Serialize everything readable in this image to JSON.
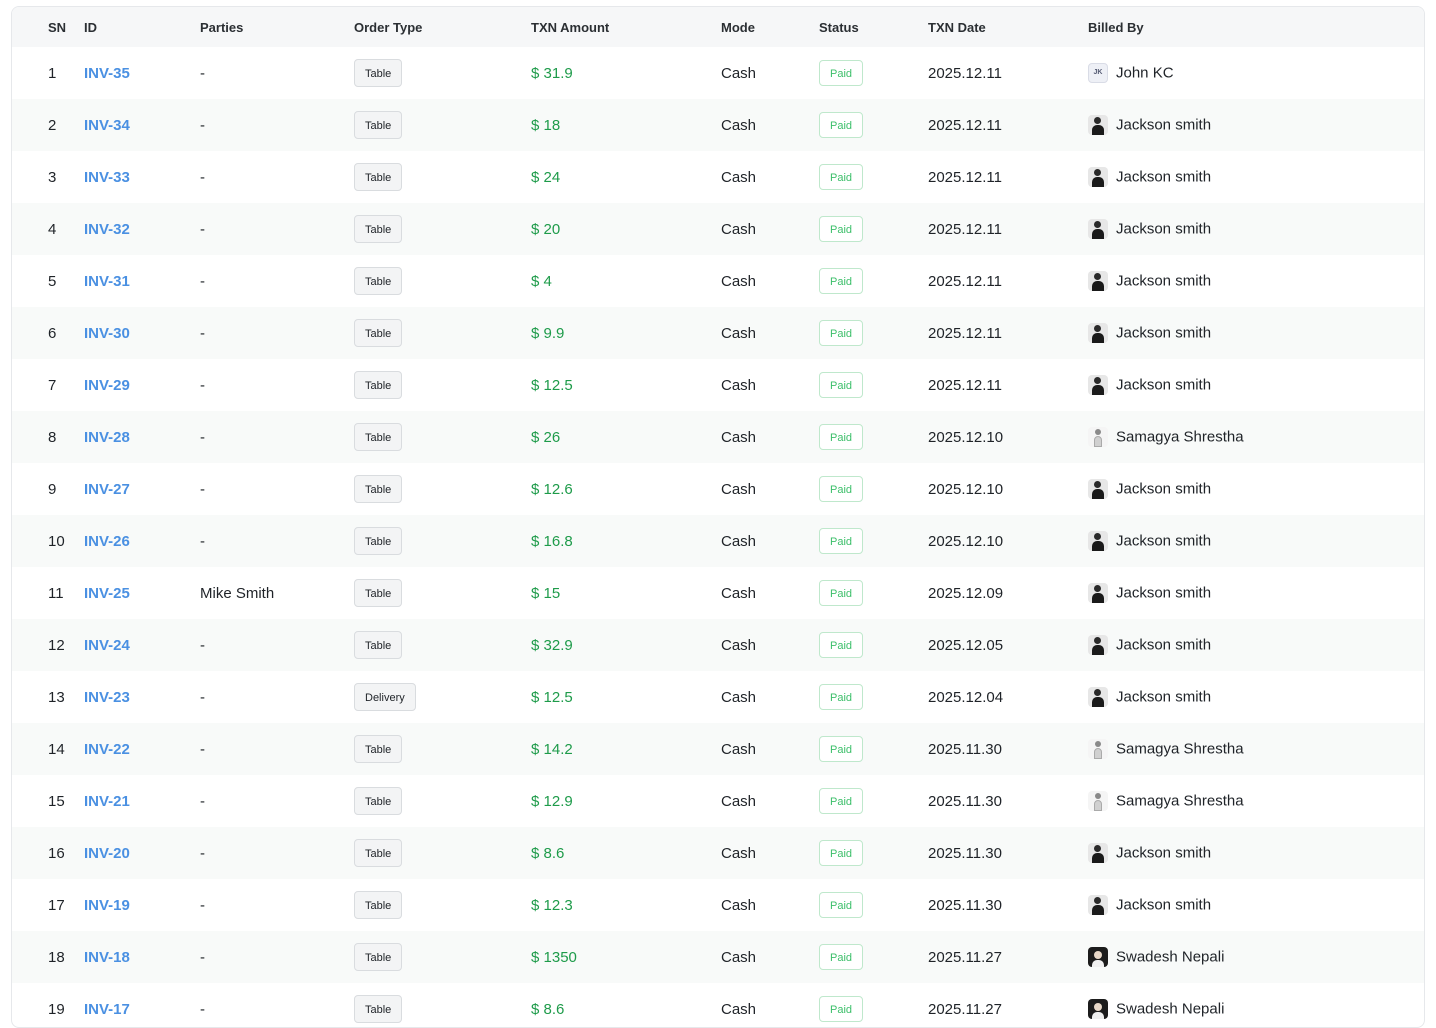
{
  "table": {
    "headers": {
      "sn": "SN",
      "id": "ID",
      "parties": "Parties",
      "order_type": "Order Type",
      "txn_amount": "TXN Amount",
      "mode": "Mode",
      "status": "Status",
      "txn_date": "TXN Date",
      "billed_by": "Billed By"
    },
    "more_icon": "···",
    "rows": [
      {
        "sn": "1",
        "id": "INV-35",
        "parties": "-",
        "order_type": "Table",
        "amount": "$ 31.9",
        "mode": "Cash",
        "status": "Paid",
        "date": "2025.12.11",
        "billed_by": "John KC",
        "avatar": "initials",
        "initials": "JK"
      },
      {
        "sn": "2",
        "id": "INV-34",
        "parties": "-",
        "order_type": "Table",
        "amount": "$ 18",
        "mode": "Cash",
        "status": "Paid",
        "date": "2025.12.11",
        "billed_by": "Jackson smith",
        "avatar": "dark"
      },
      {
        "sn": "3",
        "id": "INV-33",
        "parties": "-",
        "order_type": "Table",
        "amount": "$ 24",
        "mode": "Cash",
        "status": "Paid",
        "date": "2025.12.11",
        "billed_by": "Jackson smith",
        "avatar": "dark"
      },
      {
        "sn": "4",
        "id": "INV-32",
        "parties": "-",
        "order_type": "Table",
        "amount": "$ 20",
        "mode": "Cash",
        "status": "Paid",
        "date": "2025.12.11",
        "billed_by": "Jackson smith",
        "avatar": "dark"
      },
      {
        "sn": "5",
        "id": "INV-31",
        "parties": "-",
        "order_type": "Table",
        "amount": "$ 4",
        "mode": "Cash",
        "status": "Paid",
        "date": "2025.12.11",
        "billed_by": "Jackson smith",
        "avatar": "dark"
      },
      {
        "sn": "6",
        "id": "INV-30",
        "parties": "-",
        "order_type": "Table",
        "amount": "$ 9.9",
        "mode": "Cash",
        "status": "Paid",
        "date": "2025.12.11",
        "billed_by": "Jackson smith",
        "avatar": "dark"
      },
      {
        "sn": "7",
        "id": "INV-29",
        "parties": "-",
        "order_type": "Table",
        "amount": "$ 12.5",
        "mode": "Cash",
        "status": "Paid",
        "date": "2025.12.11",
        "billed_by": "Jackson smith",
        "avatar": "dark"
      },
      {
        "sn": "8",
        "id": "INV-28",
        "parties": "-",
        "order_type": "Table",
        "amount": "$ 26",
        "mode": "Cash",
        "status": "Paid",
        "date": "2025.12.10",
        "billed_by": "Samagya Shrestha",
        "avatar": "light"
      },
      {
        "sn": "9",
        "id": "INV-27",
        "parties": "-",
        "order_type": "Table",
        "amount": "$ 12.6",
        "mode": "Cash",
        "status": "Paid",
        "date": "2025.12.10",
        "billed_by": "Jackson smith",
        "avatar": "dark"
      },
      {
        "sn": "10",
        "id": "INV-26",
        "parties": "-",
        "order_type": "Table",
        "amount": "$ 16.8",
        "mode": "Cash",
        "status": "Paid",
        "date": "2025.12.10",
        "billed_by": "Jackson smith",
        "avatar": "dark"
      },
      {
        "sn": "11",
        "id": "INV-25",
        "parties": "Mike Smith",
        "order_type": "Table",
        "amount": "$ 15",
        "mode": "Cash",
        "status": "Paid",
        "date": "2025.12.09",
        "billed_by": "Jackson smith",
        "avatar": "dark"
      },
      {
        "sn": "12",
        "id": "INV-24",
        "parties": "-",
        "order_type": "Table",
        "amount": "$ 32.9",
        "mode": "Cash",
        "status": "Paid",
        "date": "2025.12.05",
        "billed_by": "Jackson smith",
        "avatar": "dark"
      },
      {
        "sn": "13",
        "id": "INV-23",
        "parties": "-",
        "order_type": "Delivery",
        "amount": "$ 12.5",
        "mode": "Cash",
        "status": "Paid",
        "date": "2025.12.04",
        "billed_by": "Jackson smith",
        "avatar": "dark"
      },
      {
        "sn": "14",
        "id": "INV-22",
        "parties": "-",
        "order_type": "Table",
        "amount": "$ 14.2",
        "mode": "Cash",
        "status": "Paid",
        "date": "2025.11.30",
        "billed_by": "Samagya Shrestha",
        "avatar": "light"
      },
      {
        "sn": "15",
        "id": "INV-21",
        "parties": "-",
        "order_type": "Table",
        "amount": "$ 12.9",
        "mode": "Cash",
        "status": "Paid",
        "date": "2025.11.30",
        "billed_by": "Samagya Shrestha",
        "avatar": "light"
      },
      {
        "sn": "16",
        "id": "INV-20",
        "parties": "-",
        "order_type": "Table",
        "amount": "$ 8.6",
        "mode": "Cash",
        "status": "Paid",
        "date": "2025.11.30",
        "billed_by": "Jackson smith",
        "avatar": "dark"
      },
      {
        "sn": "17",
        "id": "INV-19",
        "parties": "-",
        "order_type": "Table",
        "amount": "$ 12.3",
        "mode": "Cash",
        "status": "Paid",
        "date": "2025.11.30",
        "billed_by": "Jackson smith",
        "avatar": "dark"
      },
      {
        "sn": "18",
        "id": "INV-18",
        "parties": "-",
        "order_type": "Table",
        "amount": "$ 1350",
        "mode": "Cash",
        "status": "Paid",
        "date": "2025.11.27",
        "billed_by": "Swadesh Nepali",
        "avatar": "black"
      },
      {
        "sn": "19",
        "id": "INV-17",
        "parties": "-",
        "order_type": "Table",
        "amount": "$ 8.6",
        "mode": "Cash",
        "status": "Paid",
        "date": "2025.11.27",
        "billed_by": "Swadesh Nepali",
        "avatar": "black"
      }
    ]
  },
  "colors": {
    "link": "#4a90e2",
    "amount": "#1e9b4a",
    "status_text": "#3cbf6a",
    "status_border": "#bfe8cc",
    "header_bg": "#f6f7f8",
    "row_alt_bg": "#f8faf9"
  }
}
